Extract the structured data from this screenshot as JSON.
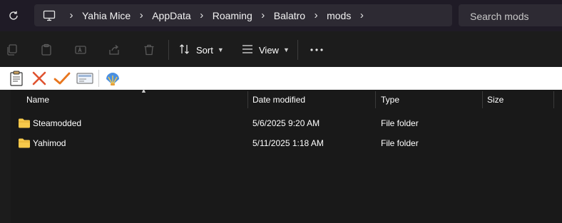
{
  "address_bar": {
    "breadcrumbs": [
      "Yahia Mice",
      "AppData",
      "Roaming",
      "Balatro",
      "mods"
    ],
    "search_placeholder": "Search mods"
  },
  "command_bar": {
    "sort_label": "Sort",
    "view_label": "View"
  },
  "columns": [
    "Name",
    "Date modified",
    "Type",
    "Size"
  ],
  "files": [
    {
      "name": "Steamodded",
      "date": "5/6/2025 9:20 AM",
      "type": "File folder",
      "size": ""
    },
    {
      "name": "Yahimod",
      "date": "5/11/2025 1:18 AM",
      "type": "File folder",
      "size": ""
    }
  ],
  "colors": {
    "background": "#191919",
    "address_bg": "#2d2a33",
    "folder": "#f6c94b",
    "accent_red": "#e0522f",
    "accent_orange": "#e8761e"
  }
}
